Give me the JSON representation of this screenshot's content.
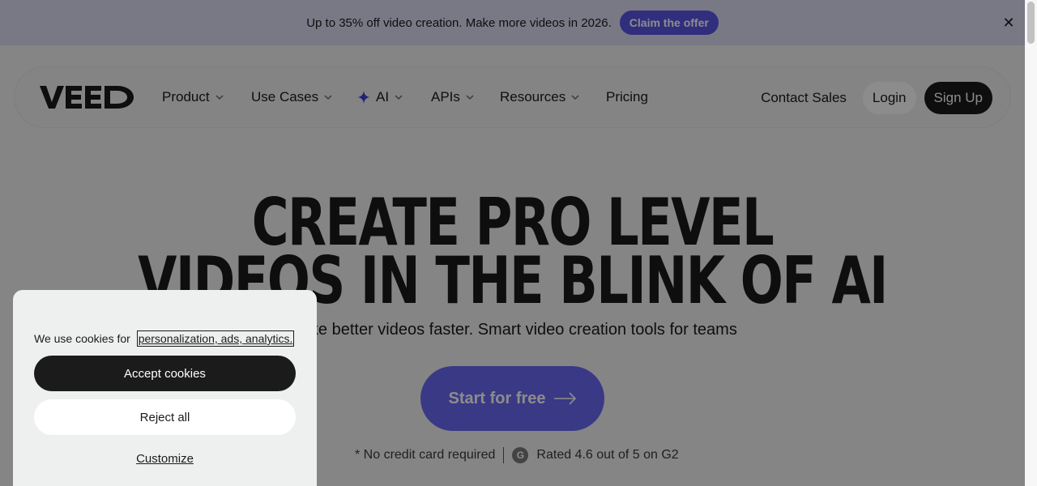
{
  "promo": {
    "text": "Up to 35% off video creation. Make more videos in 2026.",
    "cta": "Claim the offer",
    "close_icon": "close-icon"
  },
  "nav": {
    "logo": "VEED",
    "items": [
      {
        "label": "Product",
        "has_dropdown": true
      },
      {
        "label": "Use Cases",
        "has_dropdown": true
      },
      {
        "label": "AI",
        "has_dropdown": true,
        "icon": "sparkle-icon"
      },
      {
        "label": "APIs",
        "has_dropdown": true
      },
      {
        "label": "Resources",
        "has_dropdown": true
      },
      {
        "label": "Pricing",
        "has_dropdown": false
      }
    ],
    "contact": "Contact Sales",
    "login": "Login",
    "signup": "Sign Up"
  },
  "hero": {
    "title_line1": "CREATE PRO LEVEL",
    "title_line2": "VIDEOS IN THE BLINK OF AI",
    "subtitle": "Make better videos faster. Smart video creation tools for teams",
    "cta": "Start for free",
    "no_card": "* No credit card required",
    "rating": "Rated 4.6 out of 5 on G2"
  },
  "cookie": {
    "text": "We use cookies for",
    "link": "personalization, ads, analytics.",
    "accept": "Accept cookies",
    "reject": "Reject all",
    "customize": "Customize"
  },
  "colors": {
    "accent": "#5a55e6",
    "banner_bg": "#dcdcf5",
    "dark": "#1b1b1b"
  }
}
